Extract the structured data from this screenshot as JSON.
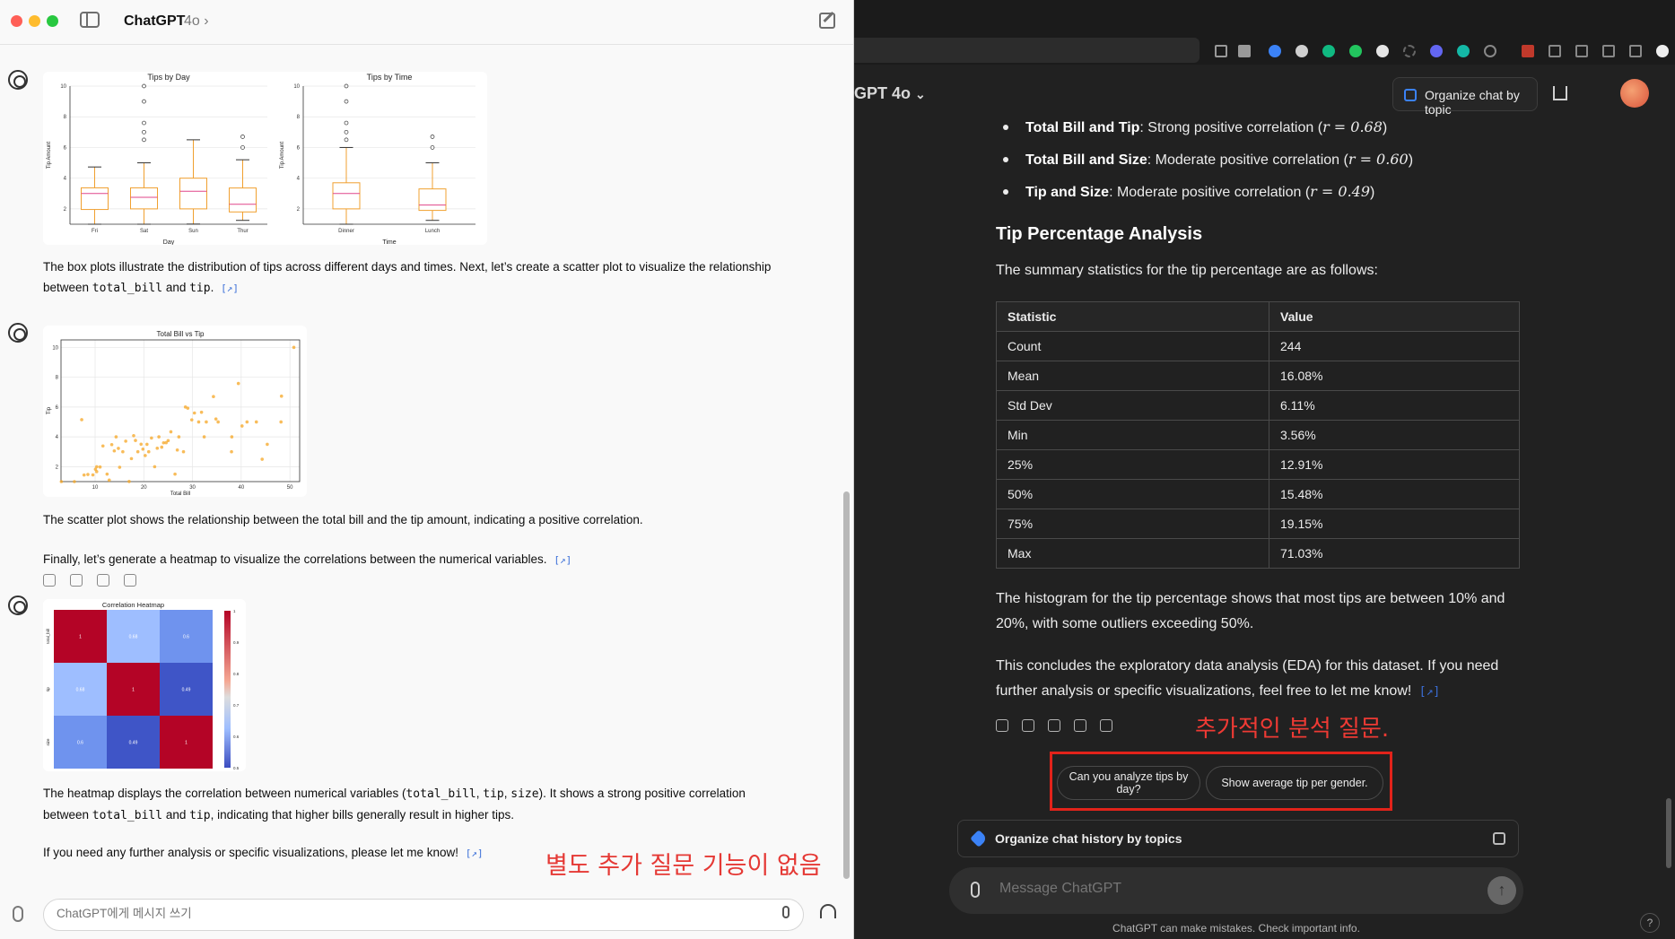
{
  "left": {
    "app_title": "ChatGPT",
    "model": "4o",
    "model_chevron": "›",
    "composer_placeholder": "ChatGPT에게 메시지 쓰기",
    "box_text": "The box plots illustrate the distribution of tips across different days and times. Next, let’s create a scatter plot to visualize the relationship between ",
    "box_code1": "total_bill",
    "box_and": " and ",
    "box_code2": "tip",
    "box_period": ".",
    "scatter_text": "The scatter plot shows the relationship between the total bill and the tip amount, indicating a positive correlation.",
    "heatmap_intro": "Finally, let’s generate a heatmap to visualize the correlations between the numerical variables.",
    "heatmap_text_1": "The heatmap displays the correlation between numerical variables (",
    "heatmap_code1": "total_bill",
    "comma": ", ",
    "heatmap_code2": "tip",
    "heatmap_code3": "size",
    "heatmap_text_2": "). It shows a strong positive correlation between ",
    "heatmap_text_3": " and ",
    "heatmap_text_4": ", indicating that higher bills generally result in higher tips.",
    "closing_text": "If you need any further analysis or specific visualizations, please let me know!",
    "source_link": "[↗]",
    "annotation": "별도 추가 질문 기능이 없음"
  },
  "right": {
    "model": "GPT 4o",
    "organize_button": "Organize chat by topic",
    "correlations": [
      {
        "label": "Total Bill and Tip",
        "text": ": Strong positive correlation (",
        "math": "r = 0.68",
        "end": ")"
      },
      {
        "label": "Total Bill and Size",
        "text": ": Moderate positive correlation (",
        "math": "r = 0.60",
        "end": ")"
      },
      {
        "label": "Tip and Size",
        "text": ": Moderate positive correlation (",
        "math": "r = 0.49",
        "end": ")"
      }
    ],
    "heading": "Tip Percentage Analysis",
    "intro": "The summary statistics for the tip percentage are as follows:",
    "table_headers": [
      "Statistic",
      "Value"
    ],
    "table_rows": [
      [
        "Count",
        "244"
      ],
      [
        "Mean",
        "16.08%"
      ],
      [
        "Std Dev",
        "6.11%"
      ],
      [
        "Min",
        "3.56%"
      ],
      [
        "25%",
        "12.91%"
      ],
      [
        "50%",
        "15.48%"
      ],
      [
        "75%",
        "19.15%"
      ],
      [
        "Max",
        "71.03%"
      ]
    ],
    "histogram_text": "The histogram for the tip percentage shows that most tips are between 10% and 20%, with some outliers exceeding 50%.",
    "conclusion_text": "This concludes the exploratory data analysis (EDA) for this dataset. If you need further analysis or specific visualizations, feel free to let me know!",
    "source_link": "[↗]",
    "annotation": "추가적인 분석 질문.",
    "suggestions": [
      "Can you analyze tips by day?",
      "Show average tip per gender."
    ],
    "organize_history": "Organize chat history by topics",
    "composer_placeholder": "Message ChatGPT",
    "send_icon": "↑",
    "disclaimer": "ChatGPT can make mistakes. Check important info.",
    "help": "?"
  },
  "charts": {
    "tips_by_day": {
      "title": "Tips by Day",
      "xlabel": "Day",
      "ylabel": "Tip Amount"
    },
    "tips_by_time": {
      "title": "Tips by Time",
      "xlabel": "Time",
      "ylabel": "Tip Amount"
    },
    "scatter": {
      "title": "Total Bill vs Tip",
      "xlabel": "Total Bill",
      "ylabel": "Tip"
    },
    "heatmap": {
      "title": "Correlation Heatmap"
    }
  },
  "chart_data": [
    {
      "type": "box",
      "title": "Tips by Day",
      "xlabel": "Day",
      "ylabel": "Tip Amount",
      "ylim": [
        1,
        10
      ],
      "yticks": [
        2,
        4,
        6,
        8,
        10
      ],
      "categories": [
        "Fri",
        "Sat",
        "Sun",
        "Thur"
      ],
      "boxes": [
        {
          "min": 1.0,
          "q1": 1.96,
          "median": 3.0,
          "q3": 3.37,
          "max": 4.73,
          "outliers": []
        },
        {
          "min": 1.0,
          "q1": 2.0,
          "median": 2.75,
          "q3": 3.37,
          "max": 5.0,
          "outliers": [
            6.5,
            7.0,
            7.6,
            9.0,
            10.0
          ]
        },
        {
          "min": 1.01,
          "q1": 2.0,
          "median": 3.15,
          "q3": 4.0,
          "max": 6.5,
          "outliers": []
        },
        {
          "min": 1.25,
          "q1": 1.8,
          "median": 2.3,
          "q3": 3.36,
          "max": 5.2,
          "outliers": [
            6.0,
            6.7
          ]
        }
      ]
    },
    {
      "type": "box",
      "title": "Tips by Time",
      "xlabel": "Time",
      "ylabel": "Tip Amount",
      "ylim": [
        1,
        10
      ],
      "yticks": [
        2,
        4,
        6,
        8,
        10
      ],
      "categories": [
        "Dinner",
        "Lunch"
      ],
      "boxes": [
        {
          "min": 1.0,
          "q1": 2.0,
          "median": 3.0,
          "q3": 3.7,
          "max": 6.0,
          "outliers": [
            6.5,
            7.0,
            7.6,
            9.0,
            10.0
          ]
        },
        {
          "min": 1.25,
          "q1": 1.9,
          "median": 2.25,
          "q3": 3.3,
          "max": 5.0,
          "outliers": [
            6.0,
            6.7
          ]
        }
      ]
    },
    {
      "type": "scatter",
      "title": "Total Bill vs Tip",
      "xlabel": "Total Bill",
      "ylabel": "Tip",
      "xlim": [
        3,
        52
      ],
      "ylim": [
        1,
        10.5
      ],
      "xticks": [
        10,
        20,
        30,
        40,
        50
      ],
      "yticks": [
        2,
        4,
        6,
        8,
        10
      ],
      "x": [
        3.07,
        5.75,
        7.25,
        7.74,
        8.52,
        9.55,
        10.07,
        10.33,
        10.34,
        11.02,
        11.61,
        12.46,
        12.9,
        13.42,
        13.94,
        14.31,
        14.78,
        15.04,
        15.69,
        16.29,
        16.99,
        17.46,
        17.92,
        18.29,
        18.78,
        19.44,
        19.82,
        20.29,
        20.65,
        21.01,
        21.58,
        22.23,
        22.76,
        23.1,
        23.68,
        24.06,
        24.59,
        25.0,
        25.56,
        26.41,
        26.88,
        27.2,
        28.15,
        28.55,
        29.03,
        29.85,
        30.4,
        31.27,
        31.85,
        32.4,
        32.83,
        34.3,
        34.81,
        35.26,
        38.01,
        38.07,
        39.42,
        40.17,
        41.19,
        43.11,
        44.3,
        45.35,
        48.17,
        48.27,
        50.81
      ],
      "y": [
        1.0,
        1.0,
        5.15,
        1.44,
        1.48,
        1.45,
        1.83,
        1.67,
        2.0,
        1.98,
        3.39,
        1.5,
        1.1,
        3.48,
        3.06,
        4.0,
        3.23,
        1.96,
        3.0,
        3.71,
        1.01,
        2.54,
        4.08,
        3.76,
        3.0,
        3.51,
        3.18,
        2.75,
        3.5,
        3.0,
        3.92,
        2.0,
        3.24,
        4.0,
        3.31,
        3.6,
        3.61,
        3.75,
        4.34,
        1.5,
        3.12,
        4.0,
        3.0,
        6.0,
        5.92,
        5.14,
        5.6,
        5.0,
        5.65,
        4.0,
        5.0,
        6.7,
        5.2,
        5.0,
        3.0,
        4.0,
        7.58,
        4.73,
        5.0,
        5.0,
        2.5,
        3.5,
        5.0,
        6.73,
        10.0
      ]
    },
    {
      "type": "heatmap",
      "title": "Correlation Heatmap",
      "rows": [
        "total_bill",
        "tip",
        "size"
      ],
      "columns": [
        "total_bill",
        "tip",
        "size"
      ],
      "values": [
        [
          1.0,
          0.68,
          0.6
        ],
        [
          0.68,
          1.0,
          0.49
        ],
        [
          0.6,
          0.49,
          1.0
        ]
      ],
      "colorbar_ticks": [
        0.5,
        0.6,
        0.7,
        0.8,
        0.9,
        1.0
      ]
    }
  ]
}
